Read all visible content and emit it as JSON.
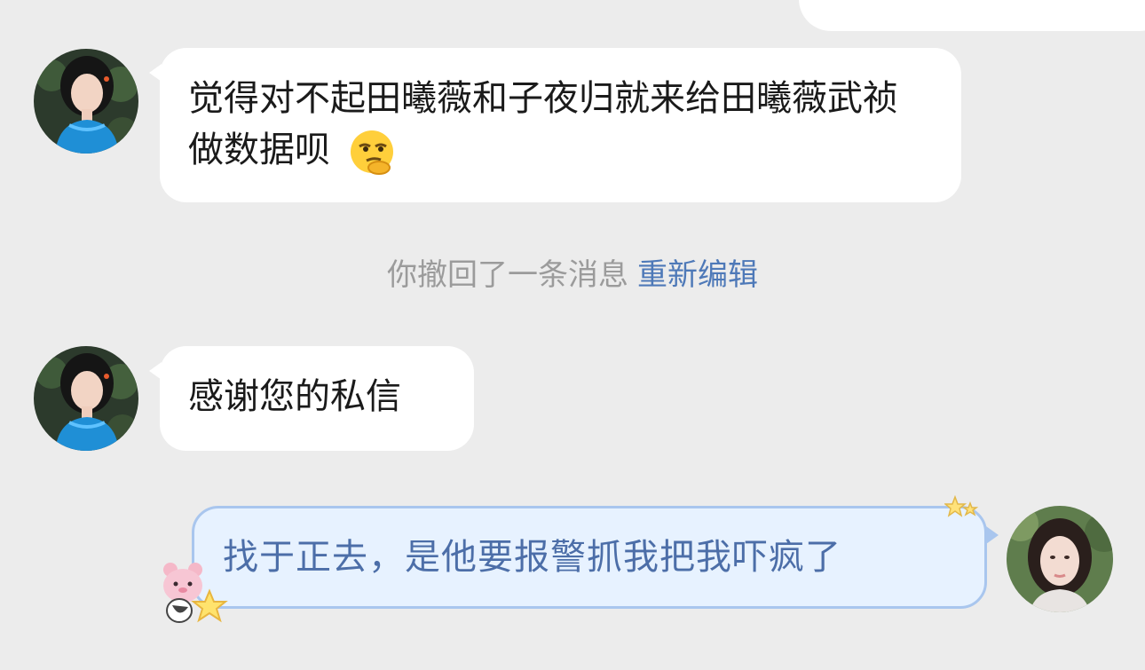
{
  "messages": [
    {
      "id": "m1",
      "side": "incoming",
      "text": "觉得对不起田曦薇和子夜归就来给田曦薇武祯做数据呗",
      "emoji": "thinking-smirk-emoji"
    },
    {
      "id": "m2",
      "side": "incoming",
      "text": "感谢您的私信"
    },
    {
      "id": "m3",
      "side": "outgoing",
      "text": "找于正去，是他要报警抓我把我吓疯了"
    }
  ],
  "system_notice": {
    "text": "你撤回了一条消息",
    "action_label": "重新编辑"
  },
  "colors": {
    "background": "#ececec",
    "incoming_bubble": "#ffffff",
    "outgoing_bubble": "#e7f2ff",
    "outgoing_border": "#a9c6ee",
    "outgoing_text": "#4c6ea8",
    "link": "#4e79b8",
    "system_text": "#9b9b9b"
  },
  "icons": [
    "avatar-contact-icon",
    "avatar-self-icon",
    "bear-sticker-icon",
    "star-sticker-icon"
  ]
}
